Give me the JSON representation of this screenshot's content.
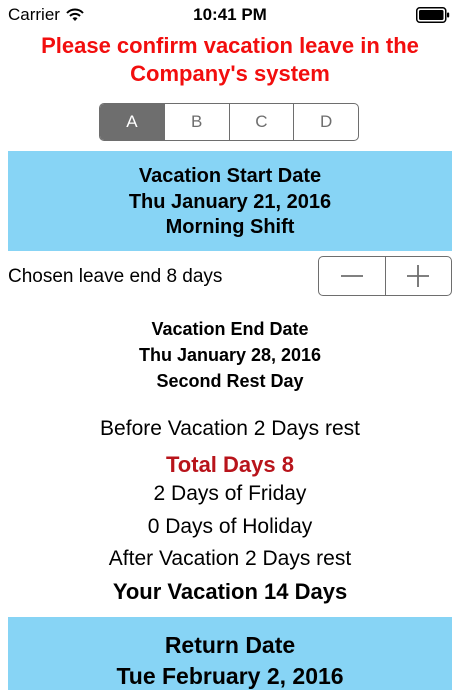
{
  "status_bar": {
    "carrier": "Carrier",
    "time": "10:41 PM"
  },
  "warning": {
    "line1": "Please confirm vacation leave in the",
    "line2": "Company's system",
    "color": "#f20e0e"
  },
  "segments": [
    {
      "label": "A",
      "selected": true
    },
    {
      "label": "B",
      "selected": false
    },
    {
      "label": "C",
      "selected": false
    },
    {
      "label": "D",
      "selected": false
    }
  ],
  "start": {
    "title": "Vacation Start Date",
    "date": "Thu January 21, 2016",
    "shift": "Morning Shift"
  },
  "leave": {
    "label": "Chosen leave end 8 days",
    "decrement_icon": "minus-icon",
    "increment_icon": "plus-icon"
  },
  "end": {
    "title": "Vacation End Date",
    "date": "Thu January 28, 2016",
    "rest": "Second Rest Day"
  },
  "summary": {
    "before": "Before Vacation 2 Days rest",
    "total": "Total Days 8",
    "fridays": "2 Days of Friday",
    "holidays": "0 Days of Holiday",
    "after": "After Vacation 2 Days rest",
    "your_vacation": "Your Vacation 14 Days"
  },
  "return": {
    "title": "Return Date",
    "date": "Tue February 2, 2016"
  },
  "colors": {
    "box_blue": "#87d4f5",
    "control_gray": "#6e6e6e",
    "total_red": "#b8141b"
  }
}
